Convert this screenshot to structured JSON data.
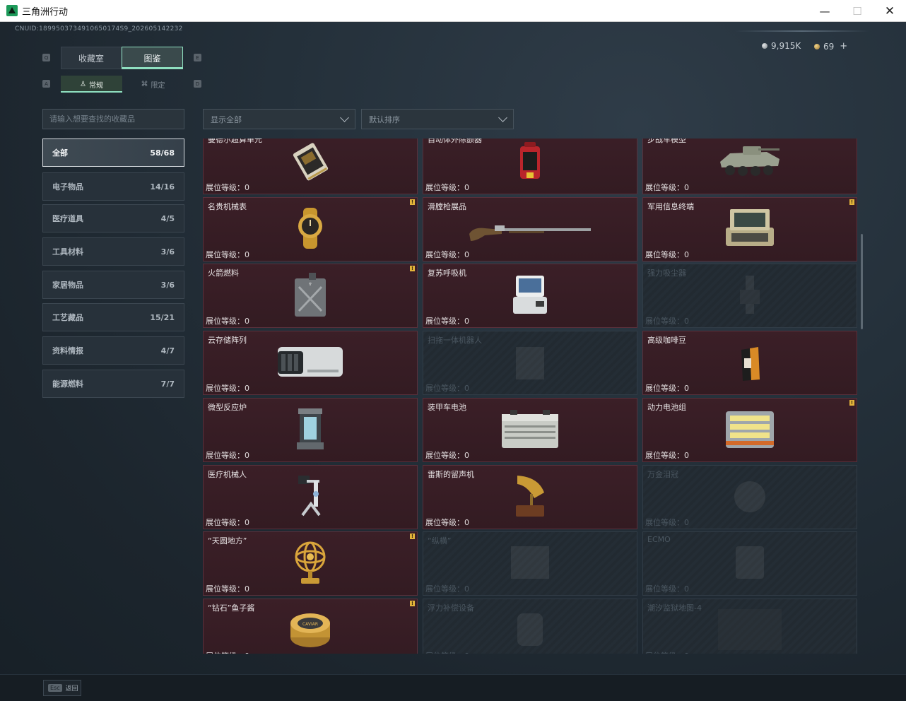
{
  "window": {
    "title": "三角洲行动",
    "minimize": "—",
    "maximize": "☐",
    "close": "✕"
  },
  "uid": "CNUID:1899503734910650174S9_202605142232",
  "currency": {
    "silver": "9,915K",
    "gold": "69",
    "add": "+"
  },
  "tabs": {
    "left_key": "Q",
    "right_key": "E",
    "items": [
      {
        "label": "收藏室"
      },
      {
        "label": "图鉴"
      }
    ]
  },
  "subtabs": {
    "left_key": "A",
    "right_key": "D",
    "items": [
      {
        "label": "常规"
      },
      {
        "label": "限定"
      }
    ]
  },
  "search": {
    "placeholder": "请输入想要查找的收藏品"
  },
  "filters": {
    "display": "显示全部",
    "sort": "默认排序"
  },
  "categories": [
    {
      "label": "全部",
      "count": "58/68"
    },
    {
      "label": "电子物品",
      "count": "14/16"
    },
    {
      "label": "医疗道具",
      "count": "4/5"
    },
    {
      "label": "工具材料",
      "count": "3/6"
    },
    {
      "label": "家居物品",
      "count": "3/6"
    },
    {
      "label": "工艺藏品",
      "count": "15/21"
    },
    {
      "label": "资料情报",
      "count": "4/7"
    },
    {
      "label": "能源燃料",
      "count": "7/7"
    }
  ],
  "level_label": "展位等级：0",
  "items": [
    {
      "name": "曼德尔超算单元",
      "unlocked": true,
      "badge": true,
      "icon": "cpu-unit-icon"
    },
    {
      "name": "自动体外除颤器",
      "unlocked": true,
      "badge": false,
      "icon": "defibrillator-icon"
    },
    {
      "name": "步战车模型",
      "unlocked": true,
      "badge": false,
      "icon": "ifv-model-icon"
    },
    {
      "name": "名贵机械表",
      "unlocked": true,
      "badge": true,
      "icon": "watch-icon"
    },
    {
      "name": "滑膛枪展品",
      "unlocked": true,
      "badge": false,
      "icon": "musket-icon"
    },
    {
      "name": "军用信息终端",
      "unlocked": true,
      "badge": true,
      "icon": "terminal-icon"
    },
    {
      "name": "火箭燃料",
      "unlocked": true,
      "badge": true,
      "icon": "fuel-can-icon"
    },
    {
      "name": "复苏呼吸机",
      "unlocked": true,
      "badge": false,
      "icon": "ventilator-icon"
    },
    {
      "name": "强力吸尘器",
      "unlocked": false,
      "badge": false,
      "icon": "vacuum-icon"
    },
    {
      "name": "云存储阵列",
      "unlocked": true,
      "badge": false,
      "icon": "storage-array-icon"
    },
    {
      "name": "扫拖一体机器人",
      "unlocked": false,
      "badge": false,
      "icon": "robot-vacuum-icon"
    },
    {
      "name": "高级咖啡豆",
      "unlocked": true,
      "badge": false,
      "icon": "coffee-bag-icon"
    },
    {
      "name": "微型反应炉",
      "unlocked": true,
      "badge": false,
      "icon": "reactor-icon"
    },
    {
      "name": "装甲车电池",
      "unlocked": true,
      "badge": false,
      "icon": "battery-box-icon"
    },
    {
      "name": "动力电池组",
      "unlocked": true,
      "badge": true,
      "icon": "battery-pack-icon"
    },
    {
      "name": "医疗机械人",
      "unlocked": true,
      "badge": false,
      "icon": "medical-robot-icon"
    },
    {
      "name": "雷斯的留声机",
      "unlocked": true,
      "badge": false,
      "icon": "gramophone-icon"
    },
    {
      "name": "万金泪冠",
      "unlocked": false,
      "badge": false,
      "icon": "crown-icon"
    },
    {
      "name": "“天圆地方”",
      "unlocked": true,
      "badge": true,
      "icon": "armillary-icon"
    },
    {
      "name": "“纵横”",
      "unlocked": false,
      "badge": false,
      "icon": "chessboard-icon"
    },
    {
      "name": "ECMO",
      "unlocked": false,
      "badge": false,
      "icon": "ecmo-icon"
    },
    {
      "name": "“钻石”鱼子酱",
      "unlocked": true,
      "badge": true,
      "icon": "caviar-tin-icon"
    },
    {
      "name": "浮力补偿设备",
      "unlocked": false,
      "badge": false,
      "icon": "bcd-icon"
    },
    {
      "name": "潮汐监狱地图-4",
      "unlocked": false,
      "badge": false,
      "icon": "map-icon"
    }
  ],
  "badge_mark": "!",
  "bottom": {
    "key": "Esc",
    "label": "返回"
  }
}
